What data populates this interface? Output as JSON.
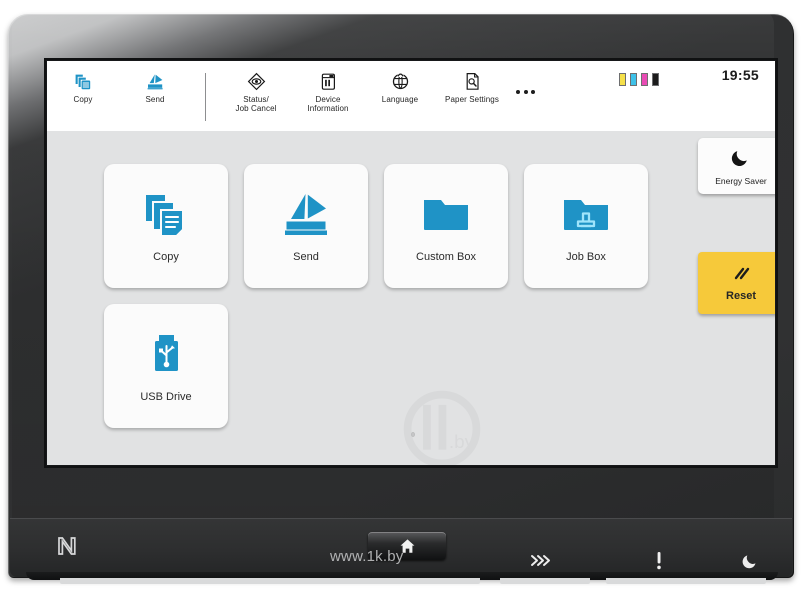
{
  "device": {
    "type": "multifunction-printer-control-panel",
    "colors": {
      "tile_icon_blue": "#1f93c6",
      "reset_amber": "#f6c93a",
      "lcd_background": "#e1e2e3",
      "header_background": "#ffffff",
      "bezel_dark": "#2f3031"
    }
  },
  "header": {
    "buttons": [
      {
        "label": "Copy",
        "icon": "copy-icon"
      },
      {
        "label": "Send",
        "icon": "send-icon"
      },
      {
        "label": "Status/\nJob Cancel",
        "icon": "status-job-cancel-icon"
      },
      {
        "label": "Device\nInformation",
        "icon": "device-information-icon"
      },
      {
        "label": "Language",
        "icon": "language-icon"
      },
      {
        "label": "Paper Settings",
        "icon": "paper-settings-icon"
      }
    ],
    "more_label": "more-options",
    "toner": [
      {
        "name": "yellow",
        "color": "#f5e04a"
      },
      {
        "name": "cyan",
        "color": "#3ec1e8"
      },
      {
        "name": "magenta",
        "color": "#e84bb4"
      },
      {
        "name": "black",
        "color": "#1c1c1c"
      }
    ],
    "clock": "19:55"
  },
  "home": {
    "tiles": [
      {
        "label": "Copy",
        "icon": "copy-documents-icon"
      },
      {
        "label": "Send",
        "icon": "send-scan-icon"
      },
      {
        "label": "Custom Box",
        "icon": "folder-icon"
      },
      {
        "label": "Job Box",
        "icon": "folder-print-icon"
      },
      {
        "label": "USB Drive",
        "icon": "usb-drive-icon"
      }
    ],
    "page_indicator": "page-1-of-1"
  },
  "rail": {
    "energy_saver": {
      "label": "Energy Saver",
      "icon": "moon-icon"
    },
    "reset": {
      "label": "Reset",
      "icon": "reset-slashes-icon"
    }
  },
  "hard_keys": {
    "nfc": "nfc-logo",
    "home": "home-icon",
    "indicators": [
      {
        "name": "processing-indicator",
        "glyph": "chevrons"
      },
      {
        "name": "attention-indicator",
        "glyph": "exclamation"
      },
      {
        "name": "energy-saver-indicator",
        "glyph": "moon"
      }
    ]
  },
  "watermark": {
    "logo": "1k.by",
    "url": "www.1k.by"
  }
}
